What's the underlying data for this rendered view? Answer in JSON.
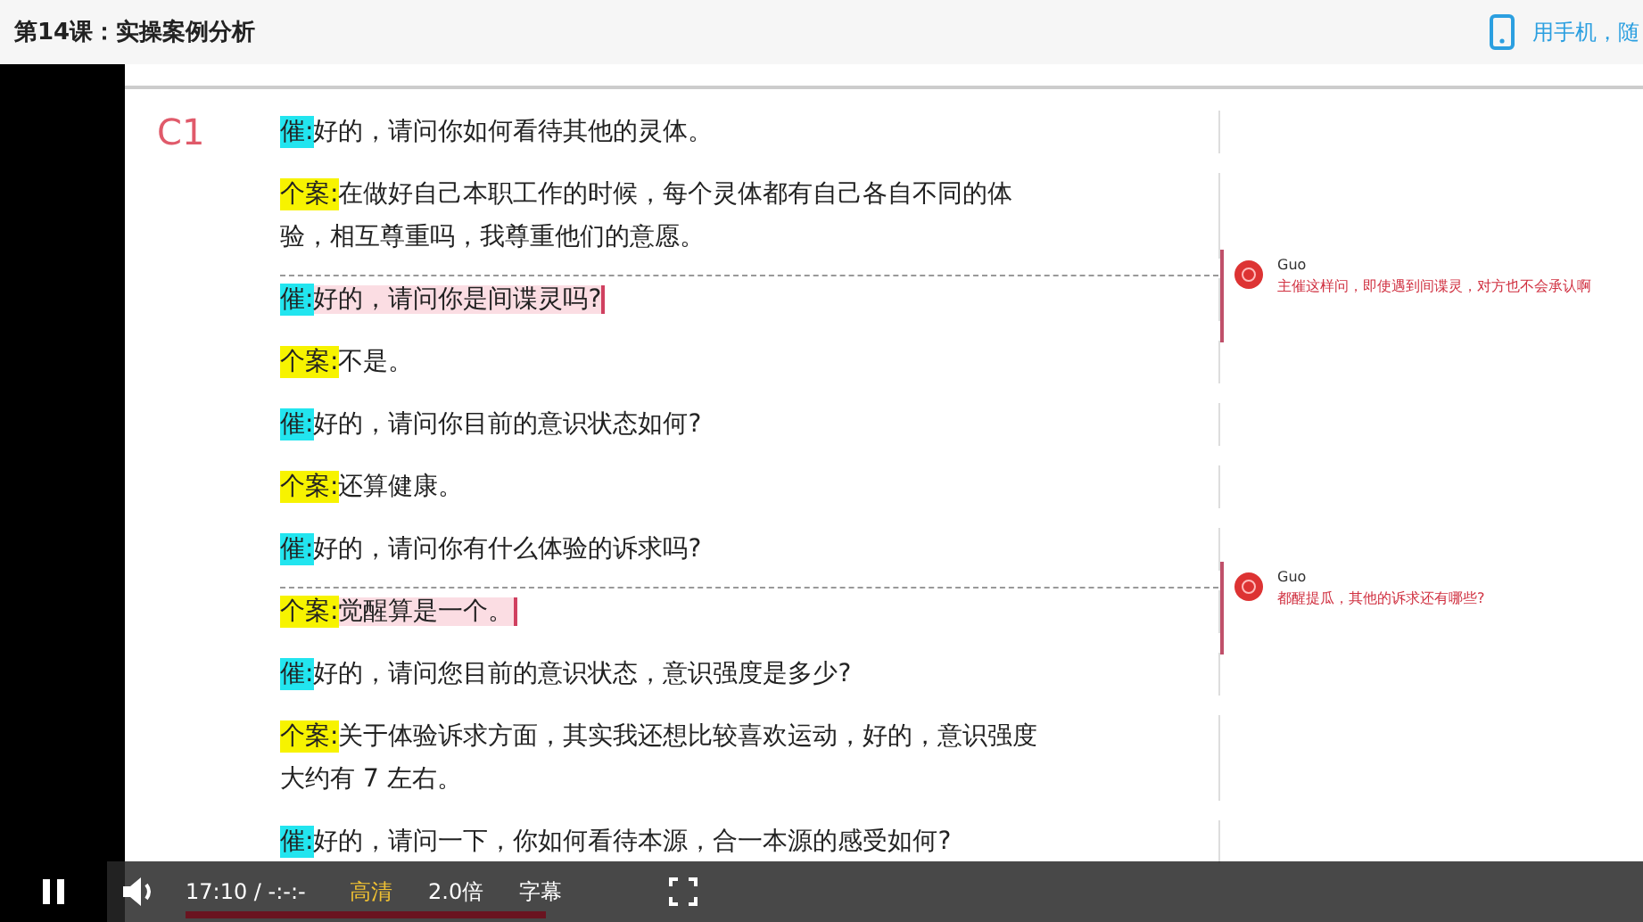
{
  "page": {
    "title": "第14课：实操案例分析",
    "mobile_link": "用手机，随"
  },
  "document": {
    "section_label": "C1",
    "entries": [
      {
        "kind": "hypnotist",
        "speaker": "催:",
        "text": "好的，请问你如何看待其他的灵体。",
        "commented": false
      },
      {
        "kind": "client",
        "speaker": "个案:",
        "text": "在做好自己本职工作的时候，每个灵体都有自己各自不同的体验，相互尊重吗，我尊重他们的意愿。",
        "commented": false
      },
      {
        "kind": "hypnotist",
        "speaker": "催:",
        "text": "好的，请问你是间谍灵吗?",
        "commented": true,
        "comment": {
          "author": "Guo",
          "text": "主催这样问，即使遇到间谍灵，对方也不会承认啊"
        }
      },
      {
        "kind": "client",
        "speaker": "个案:",
        "text": "不是。",
        "commented": false
      },
      {
        "kind": "hypnotist",
        "speaker": "催:",
        "text": "好的，请问你目前的意识状态如何?",
        "commented": false
      },
      {
        "kind": "client",
        "speaker": "个案:",
        "text": "还算健康。",
        "commented": false
      },
      {
        "kind": "hypnotist",
        "speaker": "催:",
        "text": "好的，请问你有什么体验的诉求吗?",
        "commented": false
      },
      {
        "kind": "client",
        "speaker": "个案:",
        "text": "觉醒算是一个。",
        "commented": true,
        "comment": {
          "author": "Guo",
          "text": "都醒提瓜，其他的诉求还有哪些?"
        }
      },
      {
        "kind": "hypnotist",
        "speaker": "催:",
        "text": "好的，请问您目前的意识状态，意识强度是多少?",
        "commented": false
      },
      {
        "kind": "client",
        "speaker": "个案:",
        "text": "关于体验诉求方面，其实我还想比较喜欢运动，好的，意识强度大约有 7 左右。",
        "commented": false
      },
      {
        "kind": "hypnotist",
        "speaker": "催:",
        "text": "好的，请问一下，你如何看待本源，合一本源的感受如何?",
        "commented": false
      }
    ]
  },
  "player": {
    "time": "17:10 / -:-:-",
    "quality": "高清",
    "speed": "2.0倍",
    "subtitles": "字幕",
    "progress": {
      "level": 1
    }
  }
}
